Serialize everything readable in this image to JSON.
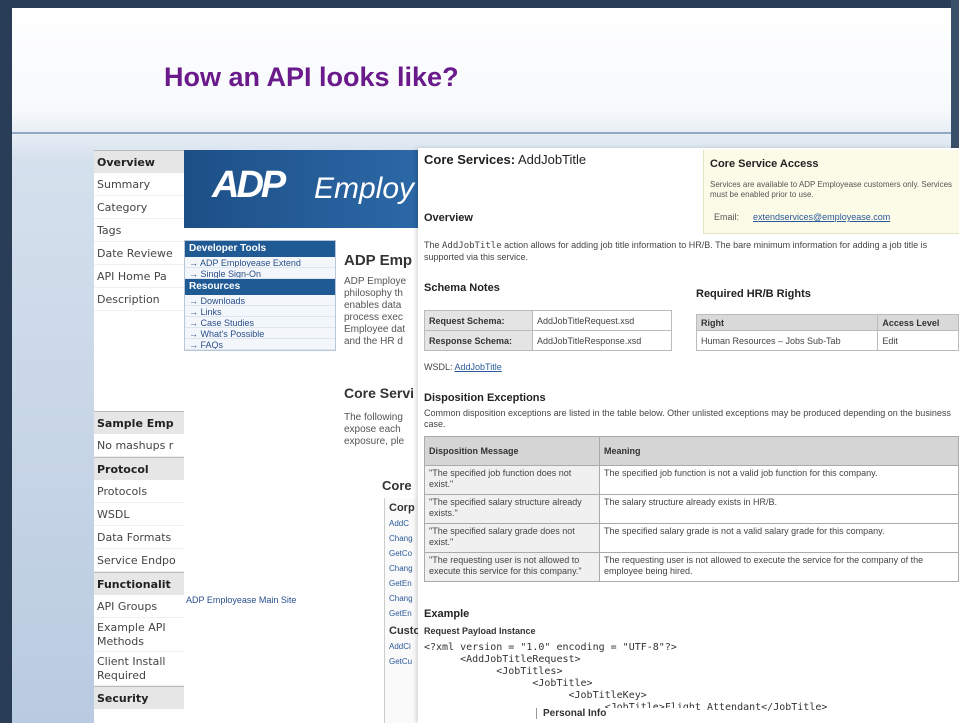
{
  "slide": {
    "title": "How an API looks like?"
  },
  "wiki": {
    "items": [
      {
        "label": "Overview",
        "type": "head"
      },
      {
        "label": "Summary",
        "type": "item"
      },
      {
        "label": "Category",
        "type": "item"
      },
      {
        "label": "Tags",
        "type": "item"
      },
      {
        "label": "Date Reviewe",
        "type": "item"
      },
      {
        "label": "API Home Pa",
        "type": "item"
      },
      {
        "label": "Description",
        "type": "item"
      },
      {
        "label": "Sample Emp",
        "type": "head"
      },
      {
        "label": "No mashups r",
        "type": "item"
      },
      {
        "label": "Protocol",
        "type": "head"
      },
      {
        "label": "Protocols",
        "type": "item"
      },
      {
        "label": "WSDL",
        "type": "item"
      },
      {
        "label": "Data Formats",
        "type": "item"
      },
      {
        "label": "Service Endpo",
        "type": "item"
      },
      {
        "label": "Functionalit",
        "type": "head"
      },
      {
        "label": "API Groups",
        "type": "item"
      },
      {
        "label": "Example API Methods",
        "type": "tall"
      },
      {
        "label": "Client Install Required",
        "type": "tall"
      },
      {
        "label": "Security",
        "type": "head"
      }
    ]
  },
  "adp": {
    "logo": "ADP",
    "logo_text": "Employ",
    "dev_tools_head": "Developer Tools",
    "dev_tools_links": [
      "→ ADP Employease Extend",
      "→ Single Sign-On"
    ],
    "resources_head": "Resources",
    "resources_links": [
      "→ Downloads",
      "→ Links",
      "→ Case Studies",
      "→ What's Possible",
      "→ FAQs"
    ],
    "heading": "ADP Emp",
    "para_lines": [
      "ADP Employe",
      "philosophy th",
      "enables data",
      "process exec",
      "Employee dat",
      "and the HR d"
    ],
    "heading2": "Core Servi",
    "para2_lines": [
      "The following",
      "expose each",
      "exposure, ple"
    ],
    "core_label": "Core",
    "corp_label": "Corp",
    "corp_links": [
      "AddC",
      "Chang",
      "GetCo",
      "Chang",
      "GetEn",
      "Chang",
      "GetEn"
    ],
    "cust_label": "Custo",
    "cust_links": [
      "AddCi",
      "GetCu"
    ],
    "main_site": "ADP Employease Main Site"
  },
  "core": {
    "title_bold": "Core Services:",
    "title_rest": " AddJobTitle",
    "access_title": "Core Service Access",
    "access_text": "Services are available to ADP Employease customers only. Services must be enabled prior to use.",
    "email_label": "Email:",
    "email_value": "extendservices@employease.com",
    "overview_head": "Overview",
    "overview_prefix": "The ",
    "overview_code": "AddJobTitle",
    "overview_text": " action allows for adding job title information to HR/B. The bare minimum information for adding a job title is supported via this service.",
    "schema_head": "Schema Notes",
    "schema_rows": [
      {
        "label": "Request Schema:",
        "value": "AddJobTitleRequest.xsd"
      },
      {
        "label": "Response Schema:",
        "value": "AddJobTitleResponse.xsd"
      }
    ],
    "rights_head": "Required HR/B Rights",
    "rights_cols": [
      "Right",
      "Access Level"
    ],
    "rights_rows": [
      {
        "right": "Human Resources – Jobs Sub-Tab",
        "level": "Edit"
      }
    ],
    "wsdl_label": "WSDL:",
    "wsdl_link": "AddJobTitle",
    "exceptions_head": "Disposition Exceptions",
    "exceptions_text": "Common disposition exceptions are listed in the table below. Other unlisted exceptions may be produced depending on the business case.",
    "exc_cols": [
      "Disposition Message",
      "Meaning"
    ],
    "exc_rows": [
      {
        "msg": "\"The specified job function does not exist.\"",
        "meaning": "The specified job function is not a valid job function for this company."
      },
      {
        "msg": "\"The specified salary structure already exists.\"",
        "meaning": "The salary structure already exists in HR/B."
      },
      {
        "msg": "\"The specified salary grade does not exist.\"",
        "meaning": "The specified salary grade is not a valid salary grade for this company."
      },
      {
        "msg": "\"The requesting user is not allowed to execute this service for this company.\"",
        "meaning": "The requesting user is not allowed to execute the service for the company of the employee being hired."
      }
    ],
    "example_head": "Example",
    "payload_head": "Request Payload Instance",
    "code": "<?xml version = \"1.0\" encoding = \"UTF-8\"?>\n      <AddJobTitleRequest>\n            <JobTitles>\n                  <JobTitle>\n                        <JobTitleKey>\n                              <JobTitle>Flight Attendant</JobTitle>",
    "personal_info": "Personal Info"
  }
}
